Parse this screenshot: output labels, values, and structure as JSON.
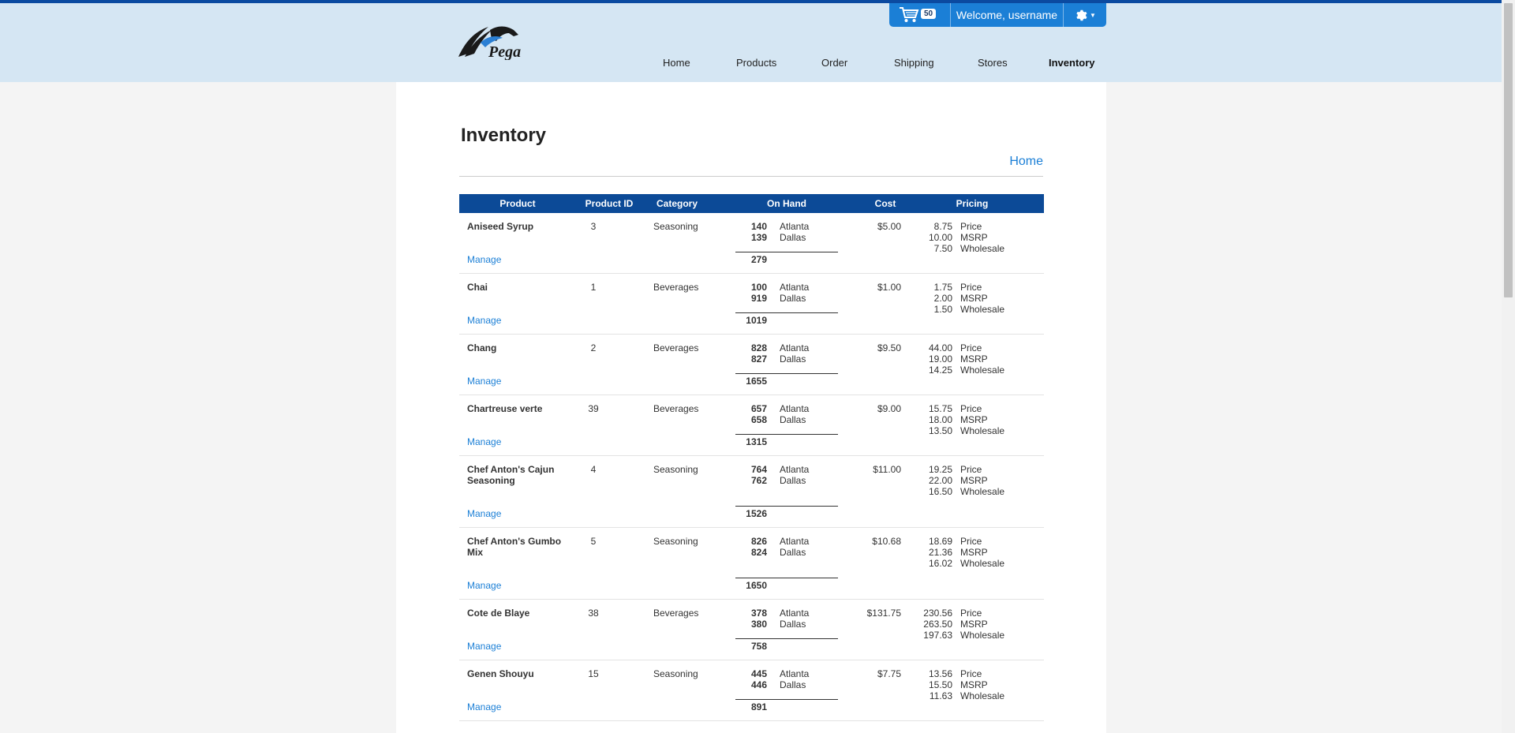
{
  "header": {
    "cart_count": "50",
    "welcome": "Welcome, username",
    "nav": [
      {
        "label": "Home",
        "active": false
      },
      {
        "label": "Products",
        "active": false
      },
      {
        "label": "Order",
        "active": false
      },
      {
        "label": "Shipping",
        "active": false
      },
      {
        "label": "Stores",
        "active": false
      },
      {
        "label": "Inventory",
        "active": true
      }
    ],
    "logo_text": "Pega"
  },
  "page": {
    "title": "Inventory",
    "breadcrumb_home": "Home"
  },
  "table": {
    "columns": [
      "Product",
      "Product ID",
      "Category",
      "On Hand",
      "Cost",
      "Pricing"
    ],
    "manage_label": "Manage",
    "rows": [
      {
        "product": "Aniseed Syrup",
        "id": "3",
        "category": "Seasoning",
        "stock": [
          {
            "qty": "140",
            "loc": "Atlanta"
          },
          {
            "qty": "139",
            "loc": "Dallas"
          }
        ],
        "total": "279",
        "cost": "$5.00",
        "pricing": [
          {
            "v": "8.75",
            "l": "Price"
          },
          {
            "v": "10.00",
            "l": "MSRP"
          },
          {
            "v": "7.50",
            "l": "Wholesale"
          }
        ]
      },
      {
        "product": "Chai",
        "id": "1",
        "category": "Beverages",
        "stock": [
          {
            "qty": "100",
            "loc": "Atlanta"
          },
          {
            "qty": "919",
            "loc": "Dallas"
          }
        ],
        "total": "1019",
        "cost": "$1.00",
        "pricing": [
          {
            "v": "1.75",
            "l": "Price"
          },
          {
            "v": "2.00",
            "l": "MSRP"
          },
          {
            "v": "1.50",
            "l": "Wholesale"
          }
        ]
      },
      {
        "product": "Chang",
        "id": "2",
        "category": "Beverages",
        "stock": [
          {
            "qty": "828",
            "loc": "Atlanta"
          },
          {
            "qty": "827",
            "loc": "Dallas"
          }
        ],
        "total": "1655",
        "cost": "$9.50",
        "pricing": [
          {
            "v": "44.00",
            "l": "Price"
          },
          {
            "v": "19.00",
            "l": "MSRP"
          },
          {
            "v": "14.25",
            "l": "Wholesale"
          }
        ]
      },
      {
        "product": "Chartreuse verte",
        "id": "39",
        "category": "Beverages",
        "stock": [
          {
            "qty": "657",
            "loc": "Atlanta"
          },
          {
            "qty": "658",
            "loc": "Dallas"
          }
        ],
        "total": "1315",
        "cost": "$9.00",
        "pricing": [
          {
            "v": "15.75",
            "l": "Price"
          },
          {
            "v": "18.00",
            "l": "MSRP"
          },
          {
            "v": "13.50",
            "l": "Wholesale"
          }
        ]
      },
      {
        "product": "Chef Anton's Cajun Seasoning",
        "id": "4",
        "category": "Seasoning",
        "stock": [
          {
            "qty": "764",
            "loc": "Atlanta"
          },
          {
            "qty": "762",
            "loc": "Dallas"
          }
        ],
        "total": "1526",
        "cost": "$11.00",
        "pricing": [
          {
            "v": "19.25",
            "l": "Price"
          },
          {
            "v": "22.00",
            "l": "MSRP"
          },
          {
            "v": "16.50",
            "l": "Wholesale"
          }
        ]
      },
      {
        "product": "Chef Anton's Gumbo Mix",
        "id": "5",
        "category": "Seasoning",
        "stock": [
          {
            "qty": "826",
            "loc": "Atlanta"
          },
          {
            "qty": "824",
            "loc": "Dallas"
          }
        ],
        "total": "1650",
        "cost": "$10.68",
        "pricing": [
          {
            "v": "18.69",
            "l": "Price"
          },
          {
            "v": "21.36",
            "l": "MSRP"
          },
          {
            "v": "16.02",
            "l": "Wholesale"
          }
        ]
      },
      {
        "product": "Cote de Blaye",
        "id": "38",
        "category": "Beverages",
        "stock": [
          {
            "qty": "378",
            "loc": "Atlanta"
          },
          {
            "qty": "380",
            "loc": "Dallas"
          }
        ],
        "total": "758",
        "cost": "$131.75",
        "pricing": [
          {
            "v": "230.56",
            "l": "Price"
          },
          {
            "v": "263.50",
            "l": "MSRP"
          },
          {
            "v": "197.63",
            "l": "Wholesale"
          }
        ]
      },
      {
        "product": "Genen Shouyu",
        "id": "15",
        "category": "Seasoning",
        "stock": [
          {
            "qty": "445",
            "loc": "Atlanta"
          },
          {
            "qty": "446",
            "loc": "Dallas"
          }
        ],
        "total": "891",
        "cost": "$7.75",
        "pricing": [
          {
            "v": "13.56",
            "l": "Price"
          },
          {
            "v": "15.50",
            "l": "MSRP"
          },
          {
            "v": "11.63",
            "l": "Wholesale"
          }
        ]
      }
    ]
  }
}
